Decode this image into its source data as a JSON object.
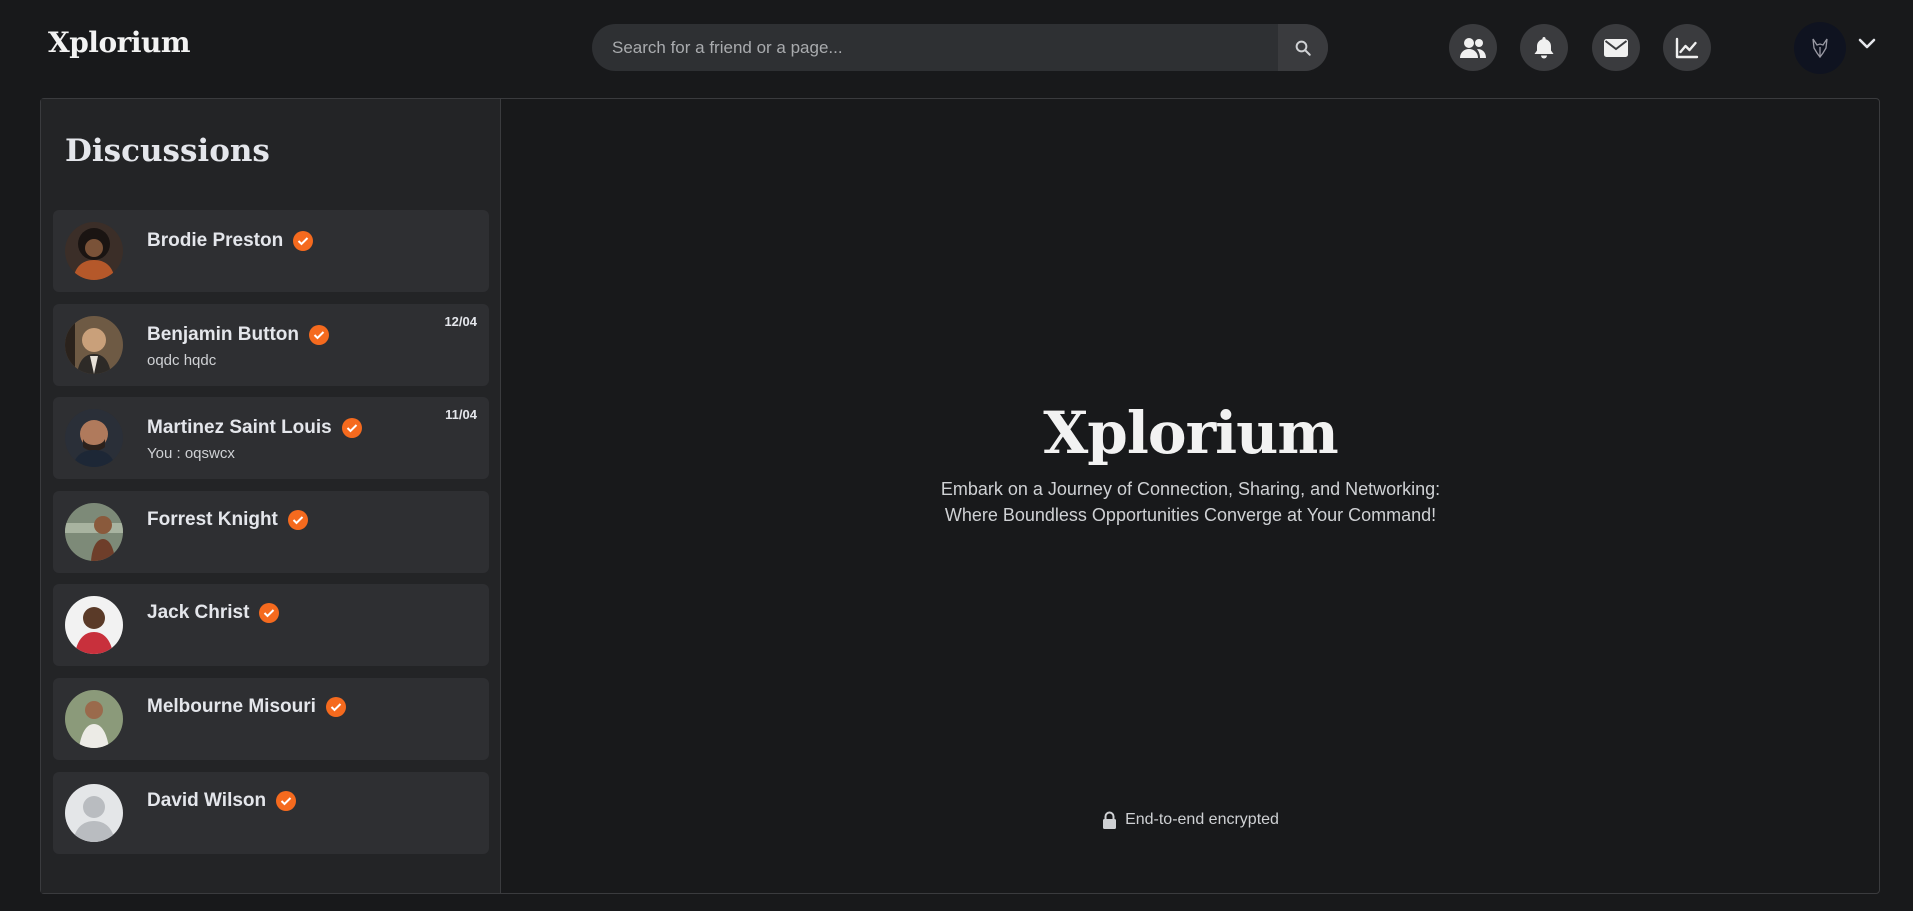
{
  "header": {
    "logo": "Xplorium",
    "search_placeholder": "Search for a friend or a page...",
    "icons": [
      "friends-icon",
      "bell-icon",
      "envelope-icon",
      "chart-line-icon"
    ]
  },
  "sidebar": {
    "title": "Discussions",
    "conversations": [
      {
        "name": "Brodie Preston",
        "preview": "",
        "date": ""
      },
      {
        "name": "Benjamin Button",
        "preview": "oqdc hqdc",
        "date": "12/04"
      },
      {
        "name": "Martinez Saint Louis",
        "preview": "You : oqswcx",
        "date": "11/04"
      },
      {
        "name": "Forrest Knight",
        "preview": "",
        "date": ""
      },
      {
        "name": "Jack Christ",
        "preview": "",
        "date": ""
      },
      {
        "name": "Melbourne Misouri",
        "preview": "",
        "date": ""
      },
      {
        "name": "David Wilson",
        "preview": "",
        "date": ""
      }
    ]
  },
  "welcome": {
    "logo": "Xplorium",
    "tagline_line1": "Embark on a Journey of Connection, Sharing, and Networking:",
    "tagline_line2": "Where Boundless Opportunities Converge at Your Command!",
    "encryption": "End-to-end encrypted"
  },
  "colors": {
    "background": "#18191b",
    "panel": "#232426",
    "card": "#2e2f32",
    "accent": "#f56a1e"
  }
}
